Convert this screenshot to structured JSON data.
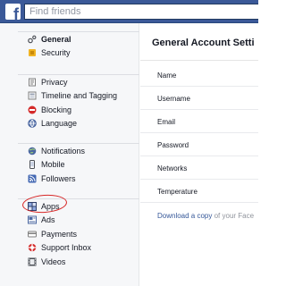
{
  "header": {
    "logo_letter": "f",
    "search_placeholder": "Find friends"
  },
  "sidebar": {
    "groups": [
      [
        {
          "label": "General",
          "icon": "gear-icon",
          "active": true
        },
        {
          "label": "Security",
          "icon": "shield-icon",
          "active": false
        }
      ],
      [
        {
          "label": "Privacy",
          "icon": "lock-icon",
          "active": false
        },
        {
          "label": "Timeline and Tagging",
          "icon": "timeline-icon",
          "active": false
        },
        {
          "label": "Blocking",
          "icon": "block-icon",
          "active": false
        },
        {
          "label": "Language",
          "icon": "globe-icon",
          "active": false
        }
      ],
      [
        {
          "label": "Notifications",
          "icon": "globe-notification-icon",
          "active": false
        },
        {
          "label": "Mobile",
          "icon": "mobile-icon",
          "active": false
        },
        {
          "label": "Followers",
          "icon": "rss-icon",
          "active": false
        }
      ],
      [
        {
          "label": "Apps",
          "icon": "apps-icon",
          "active": false
        },
        {
          "label": "Ads",
          "icon": "ads-icon",
          "active": false
        },
        {
          "label": "Payments",
          "icon": "payments-icon",
          "active": false
        },
        {
          "label": "Support Inbox",
          "icon": "support-icon",
          "active": false
        },
        {
          "label": "Videos",
          "icon": "film-icon",
          "active": false
        }
      ]
    ]
  },
  "main": {
    "title": "General Account Setti",
    "rows": [
      "Name",
      "Username",
      "Email",
      "Password",
      "Networks",
      "Temperature"
    ],
    "download_link": "Download a copy",
    "download_rest": " of your Face"
  },
  "colors": {
    "brand_blue": "#3b5998",
    "link_blue": "#365899",
    "annotation_red": "#d72828"
  }
}
